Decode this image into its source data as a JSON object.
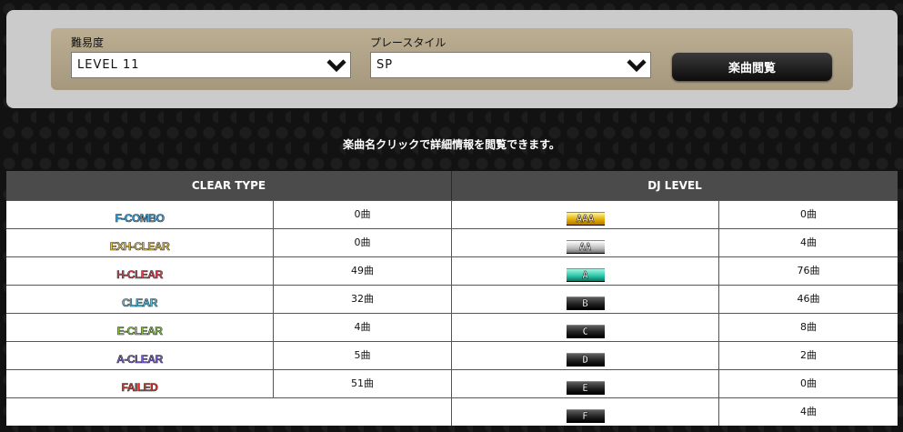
{
  "filters": {
    "difficulty_label": "難易度",
    "difficulty_value": "LEVEL 11",
    "play_style_label": "プレースタイル",
    "play_style_value": "SP",
    "view_button": "楽曲閲覧"
  },
  "notice": "楽曲名クリックで詳細情報を閲覧できます。",
  "table": {
    "clear_type_header": "CLEAR TYPE",
    "dj_level_header": "DJ LEVEL",
    "clear_types": [
      {
        "label": "F-COMBO",
        "count": "0曲",
        "color": "#3aa8e8"
      },
      {
        "label": "EXH-CLEAR",
        "count": "0曲",
        "color": "#e8c94a"
      },
      {
        "label": "H-CLEAR",
        "count": "49曲",
        "color": "#ee3c4c"
      },
      {
        "label": "CLEAR",
        "count": "32曲",
        "color": "#4fc8ea"
      },
      {
        "label": "E-CLEAR",
        "count": "4曲",
        "color": "#8fd14a"
      },
      {
        "label": "A-CLEAR",
        "count": "5曲",
        "color": "#7b5de0"
      },
      {
        "label": "FAILED",
        "count": "51曲",
        "color": "#e8312a"
      }
    ],
    "dj_levels": [
      {
        "label": "AAA",
        "count": "0曲"
      },
      {
        "label": "AA",
        "count": "4曲"
      },
      {
        "label": "A",
        "count": "76曲"
      },
      {
        "label": "B",
        "count": "46曲"
      },
      {
        "label": "C",
        "count": "8曲"
      },
      {
        "label": "D",
        "count": "2曲"
      },
      {
        "label": "E",
        "count": "0曲"
      },
      {
        "label": "F",
        "count": "4曲"
      }
    ]
  }
}
